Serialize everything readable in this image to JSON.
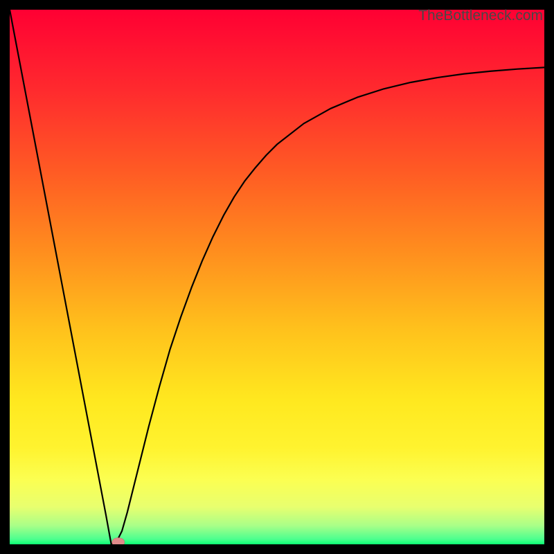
{
  "watermark": "TheBottleneck.com",
  "chart_data": {
    "type": "line",
    "title": "",
    "xlabel": "",
    "ylabel": "",
    "xlim": [
      0,
      100
    ],
    "ylim": [
      0,
      100
    ],
    "x": [
      0,
      2,
      4,
      6,
      8,
      10,
      12,
      14,
      16,
      18,
      19,
      20,
      21,
      22,
      24,
      26,
      28,
      30,
      32,
      34,
      36,
      38,
      40,
      42,
      44,
      46,
      48,
      50,
      55,
      60,
      65,
      70,
      75,
      80,
      85,
      90,
      95,
      100
    ],
    "y": [
      100,
      89.5,
      79,
      68.5,
      58,
      47.5,
      37,
      26.5,
      16,
      5.5,
      0,
      0.5,
      2.5,
      6,
      14,
      22,
      29.5,
      36.5,
      42.5,
      48,
      53,
      57.5,
      61.5,
      65,
      68,
      70.5,
      72.8,
      74.8,
      78.7,
      81.5,
      83.6,
      85.2,
      86.4,
      87.3,
      88,
      88.5,
      88.9,
      89.2
    ],
    "marker": {
      "x": 20.3,
      "y": 0
    },
    "gradient_stops": [
      {
        "offset": 0.0,
        "color": "#ff0033"
      },
      {
        "offset": 0.15,
        "color": "#ff2a2e"
      },
      {
        "offset": 0.3,
        "color": "#ff5a24"
      },
      {
        "offset": 0.45,
        "color": "#ff8d1e"
      },
      {
        "offset": 0.6,
        "color": "#ffc21c"
      },
      {
        "offset": 0.73,
        "color": "#ffe81f"
      },
      {
        "offset": 0.82,
        "color": "#fff32f"
      },
      {
        "offset": 0.88,
        "color": "#fbff52"
      },
      {
        "offset": 0.93,
        "color": "#e8ff6f"
      },
      {
        "offset": 0.965,
        "color": "#a9ff88"
      },
      {
        "offset": 0.99,
        "color": "#4eff8f"
      },
      {
        "offset": 1.0,
        "color": "#0cff72"
      }
    ]
  }
}
